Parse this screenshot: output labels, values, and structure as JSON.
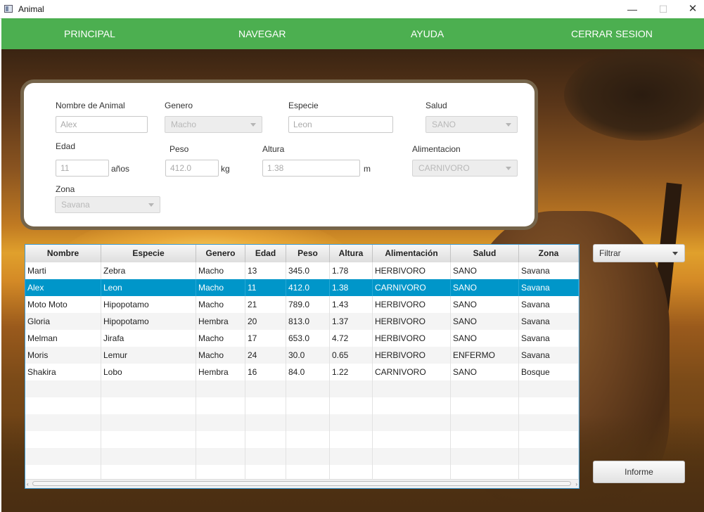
{
  "window": {
    "title": "Animal",
    "minimize_glyph": "—",
    "maximize_glyph": "☐",
    "close_glyph": "✕"
  },
  "nav": {
    "principal": "PRINCIPAL",
    "navegar": "NAVEGAR",
    "ayuda": "AYUDA",
    "cerrar": "CERRAR SESION"
  },
  "form": {
    "nombre": {
      "label": "Nombre de Animal",
      "value": "Alex"
    },
    "genero": {
      "label": "Genero",
      "value": "Macho"
    },
    "especie": {
      "label": "Especie",
      "value": "Leon"
    },
    "salud": {
      "label": "Salud",
      "value": "SANO"
    },
    "edad": {
      "label": "Edad",
      "value": "11",
      "unit": "años"
    },
    "peso": {
      "label": "Peso",
      "value": "412.0",
      "unit": "kg"
    },
    "altura": {
      "label": "Altura",
      "value": "1.38",
      "unit": "m"
    },
    "alimentacion": {
      "label": "Alimentacion",
      "value": "CARNIVORO"
    },
    "zona": {
      "label": "Zona",
      "value": "Savana"
    }
  },
  "table": {
    "columns": [
      "Nombre",
      "Especie",
      "Genero",
      "Edad",
      "Peso",
      "Altura",
      "Alimentación",
      "Salud",
      "Zona"
    ],
    "rows": [
      [
        "Marti",
        "Zebra",
        "Macho",
        "13",
        "345.0",
        "1.78",
        "HERBIVORO",
        "SANO",
        "Savana"
      ],
      [
        "Alex",
        "Leon",
        "Macho",
        "11",
        "412.0",
        "1.38",
        "CARNIVORO",
        "SANO",
        "Savana"
      ],
      [
        "Moto Moto",
        "Hipopotamo",
        "Macho",
        "21",
        "789.0",
        "1.43",
        "HERBIVORO",
        "SANO",
        "Savana"
      ],
      [
        "Gloria",
        "Hipopotamo",
        "Hembra",
        "20",
        "813.0",
        "1.37",
        "HERBIVORO",
        "SANO",
        "Savana"
      ],
      [
        "Melman",
        "Jirafa",
        "Macho",
        "17",
        "653.0",
        "4.72",
        "HERBIVORO",
        "SANO",
        "Savana"
      ],
      [
        "Moris",
        "Lemur",
        "Macho",
        "24",
        "30.0",
        "0.65",
        "HERBIVORO",
        "ENFERMO",
        "Savana"
      ],
      [
        "Shakira",
        "Lobo",
        "Hembra",
        "16",
        "84.0",
        "1.22",
        "CARNIVORO",
        "SANO",
        "Bosque"
      ]
    ],
    "selected_index": 1,
    "empty_rows": 6,
    "scroll_left_glyph": "‹",
    "scroll_right_glyph": "›"
  },
  "filter": {
    "label": "Filtrar"
  },
  "informe": {
    "label": "Informe"
  },
  "colors": {
    "nav": "#4caf50",
    "selection": "#0096c9",
    "card_border": "#75644a"
  }
}
